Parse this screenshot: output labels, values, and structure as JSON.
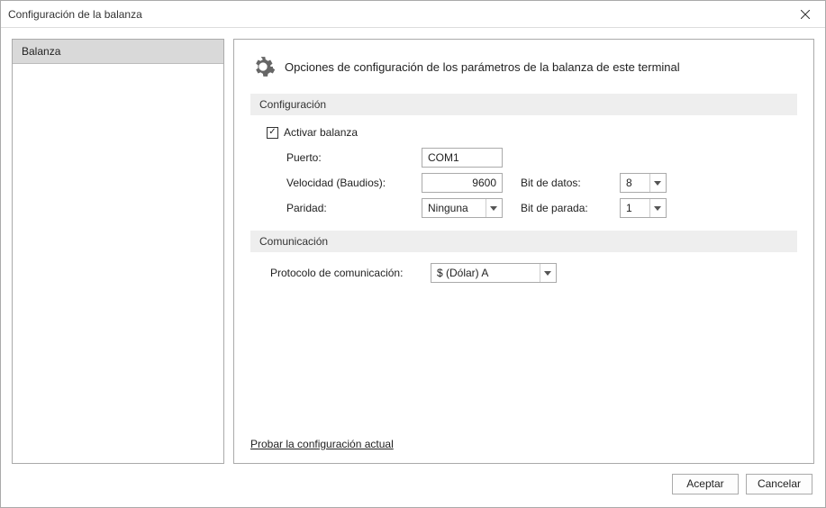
{
  "window": {
    "title": "Configuración de la balanza"
  },
  "sidebar": {
    "items": [
      {
        "label": "Balanza"
      }
    ]
  },
  "main": {
    "header": "Opciones de configuración de los parámetros de la balanza de este terminal",
    "sections": {
      "config": {
        "title": "Configuración",
        "enable_checkbox": {
          "label": "Activar balanza",
          "checked": true
        },
        "fields": {
          "port_label": "Puerto:",
          "port_value": "COM1",
          "baud_label": "Velocidad (Baudios):",
          "baud_value": "9600",
          "databits_label": "Bit de datos:",
          "databits_value": "8",
          "parity_label": "Paridad:",
          "parity_value": "Ninguna",
          "stopbits_label": "Bit de parada:",
          "stopbits_value": "1"
        }
      },
      "comm": {
        "title": "Comunicación",
        "protocol_label": "Protocolo de comunicación:",
        "protocol_value": "$ (Dólar) A"
      }
    },
    "test_link": "Probar la configuración actual"
  },
  "footer": {
    "accept": "Aceptar",
    "cancel": "Cancelar"
  }
}
